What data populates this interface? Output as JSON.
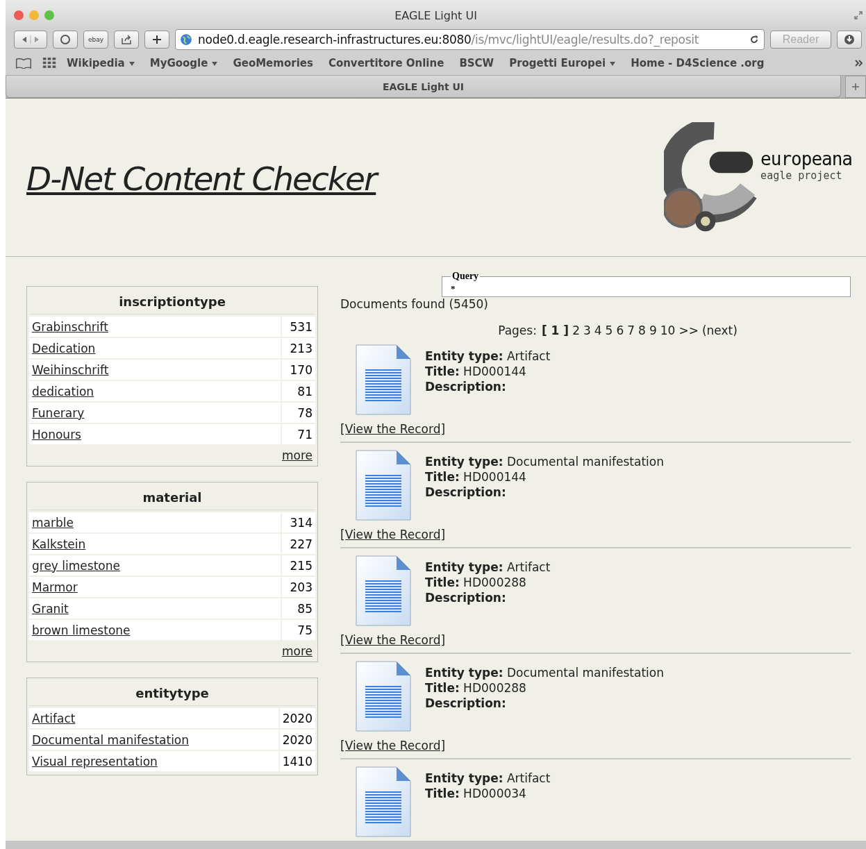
{
  "window": {
    "title": "EAGLE Light UI"
  },
  "toolbar": {
    "url_host": "node0.d.eagle.research-infrastructures.eu:8080",
    "url_path": "/is/mvc/lightUI/eagle/results.do?_reposit",
    "reader": "Reader",
    "ebay": "ebay"
  },
  "bookmarks": [
    {
      "label": "Wikipedia",
      "menu": true
    },
    {
      "label": "MyGoogle",
      "menu": true
    },
    {
      "label": "GeoMemories",
      "menu": false
    },
    {
      "label": "Convertitore Online",
      "menu": false
    },
    {
      "label": "BSCW",
      "menu": false
    },
    {
      "label": "Progetti Europei",
      "menu": true
    },
    {
      "label": "Home - D4Science .org",
      "menu": false
    }
  ],
  "tab": {
    "title": "EAGLE Light UI"
  },
  "header": {
    "title": "D-Net Content Checker",
    "logo_name": "europeana",
    "logo_sub": "eagle project"
  },
  "facets": [
    {
      "title": "inscriptiontype",
      "more": "more",
      "items": [
        {
          "name": "Grabinschrift",
          "count": "531"
        },
        {
          "name": "Dedication",
          "count": "213"
        },
        {
          "name": "Weihinschrift",
          "count": "170"
        },
        {
          "name": "dedication",
          "count": "81"
        },
        {
          "name": "Funerary",
          "count": "78"
        },
        {
          "name": "Honours",
          "count": "71"
        }
      ]
    },
    {
      "title": "material",
      "more": "more",
      "items": [
        {
          "name": "marble",
          "count": "314"
        },
        {
          "name": "Kalkstein",
          "count": "227"
        },
        {
          "name": "grey limestone",
          "count": "215"
        },
        {
          "name": "Marmor",
          "count": "203"
        },
        {
          "name": "Granit",
          "count": "85"
        },
        {
          "name": "brown limestone",
          "count": "75"
        }
      ]
    },
    {
      "title": "entitytype",
      "items": [
        {
          "name": "Artifact",
          "count": "2020"
        },
        {
          "name": "Documental manifestation",
          "count": "2020"
        },
        {
          "name": "Visual representation",
          "count": "1410"
        }
      ]
    }
  ],
  "query": {
    "legend": "Query",
    "value": "*"
  },
  "documents_found": "Documents found (5450)",
  "pagination": {
    "label": "Pages:",
    "pages": [
      {
        "label": "1",
        "selected": true
      },
      {
        "label": "2",
        "selected": false
      },
      {
        "label": "3",
        "selected": false
      },
      {
        "label": "4",
        "selected": false
      },
      {
        "label": "5",
        "selected": false
      },
      {
        "label": "6",
        "selected": false
      },
      {
        "label": "7",
        "selected": false
      },
      {
        "label": "8",
        "selected": false
      },
      {
        "label": "9",
        "selected": false
      },
      {
        "label": "10",
        "selected": false
      }
    ],
    "current_open": "[",
    "current_close": "]",
    "forward": ">>",
    "next": "(next)"
  },
  "records": [
    {
      "entity_label": "Entity type:",
      "entity": "Artifact",
      "title_label": "Title:",
      "title": "HD000144",
      "description_label": "Description:",
      "link": "[View the Record]"
    },
    {
      "entity_label": "Entity type:",
      "entity": "Documental manifestation",
      "title_label": "Title:",
      "title": "HD000144",
      "description_label": "Description:",
      "link": "[View the Record]"
    },
    {
      "entity_label": "Entity type:",
      "entity": "Artifact",
      "title_label": "Title:",
      "title": "HD000288",
      "description_label": "Description:",
      "link": "[View the Record]"
    },
    {
      "entity_label": "Entity type:",
      "entity": "Documental manifestation",
      "title_label": "Title:",
      "title": "HD000288",
      "description_label": "Description:",
      "link": "[View the Record]"
    },
    {
      "entity_label": "Entity type:",
      "entity": "Artifact",
      "title_label": "Title:",
      "title": "HD000034"
    }
  ]
}
